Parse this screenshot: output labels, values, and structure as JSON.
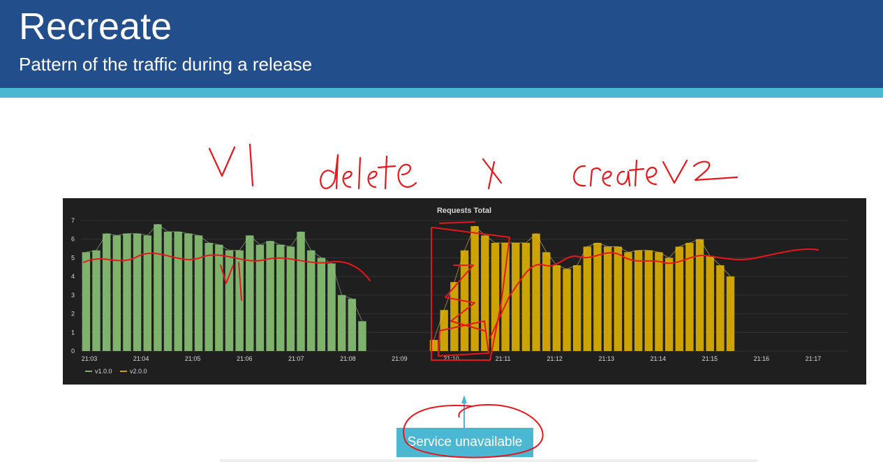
{
  "slide": {
    "title": "Recreate",
    "subtitle": "Pattern of the traffic during a release"
  },
  "annotations": {
    "v1_label": "V1",
    "delete_label": "delete",
    "x_label": "x",
    "create_label": "createV2",
    "chart_v1_label": "V1",
    "ink_color": "#e8161b"
  },
  "callout": {
    "label": "Service unavailable",
    "color": "#4bb8d3"
  },
  "chart_data": {
    "type": "bar",
    "title": "Requests Total",
    "xlabel": "",
    "ylabel": "",
    "ylim": [
      0,
      7
    ],
    "yticks": [
      0,
      1,
      2,
      3,
      4,
      5,
      6,
      7
    ],
    "xticks": [
      "21:03",
      "21:04",
      "21:05",
      "21:06",
      "21:07",
      "21:08",
      "21:09",
      "21:10",
      "21:11",
      "21:12",
      "21:13",
      "21:14",
      "21:15",
      "21:16",
      "21:17"
    ],
    "grid": true,
    "legend_position": "bottom-left",
    "background": "#1f1f1f",
    "series": [
      {
        "name": "v1.0.0",
        "color": "#7eb26d",
        "values": [
          5.3,
          5.4,
          6.3,
          6.2,
          6.3,
          6.3,
          6.2,
          6.8,
          6.4,
          6.4,
          6.3,
          6.2,
          5.8,
          5.7,
          5.4,
          5.4,
          6.2,
          5.7,
          5.9,
          5.7,
          5.6,
          6.4,
          5.4,
          5.0,
          4.7,
          3.0,
          2.8,
          1.6,
          0,
          0,
          0,
          0,
          0,
          0,
          0,
          0,
          0,
          0,
          0,
          0,
          0,
          0,
          0,
          0,
          0,
          0,
          0,
          0,
          0,
          0,
          0,
          0,
          0,
          0,
          0,
          0,
          0,
          0,
          0,
          0,
          0,
          0,
          0,
          0,
          0,
          0,
          0,
          0,
          0,
          0,
          0,
          0,
          0,
          0,
          0
        ]
      },
      {
        "name": "v2.0.0",
        "color": "#cca300",
        "values": [
          0,
          0,
          0,
          0,
          0,
          0,
          0,
          0,
          0,
          0,
          0,
          0,
          0,
          0,
          0,
          0,
          0,
          0,
          0,
          0,
          0,
          0,
          0,
          0,
          0,
          0,
          0,
          0,
          0,
          0,
          0,
          0,
          0,
          0,
          0.6,
          2.2,
          3.7,
          5.4,
          6.7,
          6.2,
          5.8,
          5.8,
          5.8,
          5.8,
          6.3,
          5.3,
          4.6,
          4.4,
          4.6,
          5.6,
          5.8,
          5.6,
          5.6,
          5.3,
          5.4,
          5.4,
          5.3,
          5.0,
          5.6,
          5.8,
          6.0,
          5.1,
          4.6,
          4.0
        ]
      }
    ]
  }
}
